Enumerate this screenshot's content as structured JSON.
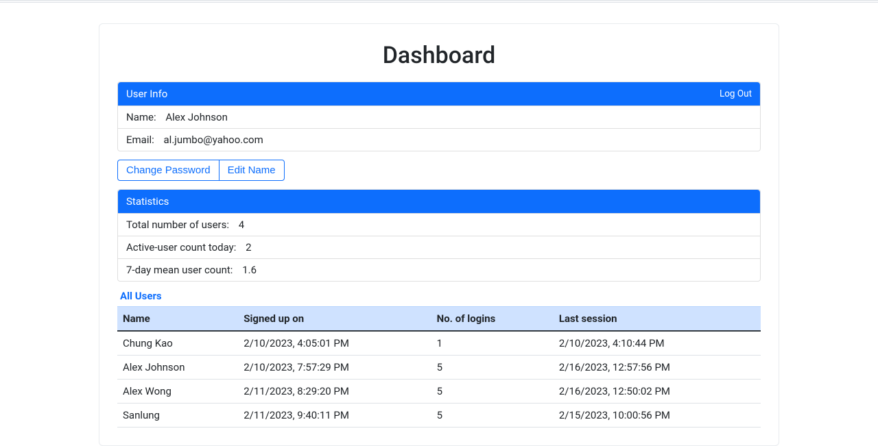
{
  "page": {
    "title": "Dashboard"
  },
  "userInfo": {
    "header": "User Info",
    "logout": "Log Out",
    "nameLabel": "Name:",
    "nameValue": "Alex Johnson",
    "emailLabel": "Email:",
    "emailValue": "al.jumbo@yahoo.com"
  },
  "buttons": {
    "changePassword": "Change Password",
    "editName": "Edit Name"
  },
  "statistics": {
    "header": "Statistics",
    "totalLabel": "Total number of users:",
    "totalValue": "4",
    "activeLabel": "Active-user count today:",
    "activeValue": "2",
    "meanLabel": "7-day mean user count:",
    "meanValue": "1.6"
  },
  "allUsers": {
    "title": "All Users",
    "columns": {
      "name": "Name",
      "signedUp": "Signed up on",
      "logins": "No. of logins",
      "lastSession": "Last session"
    },
    "rows": [
      {
        "name": "Chung Kao",
        "signedUp": "2/10/2023, 4:05:01 PM",
        "logins": "1",
        "lastSession": "2/10/2023, 4:10:44 PM"
      },
      {
        "name": "Alex Johnson",
        "signedUp": "2/10/2023, 7:57:29 PM",
        "logins": "5",
        "lastSession": "2/16/2023, 12:57:56 PM"
      },
      {
        "name": "Alex Wong",
        "signedUp": "2/11/2023, 8:29:20 PM",
        "logins": "5",
        "lastSession": "2/16/2023, 12:50:02 PM"
      },
      {
        "name": "Sanlung",
        "signedUp": "2/11/2023, 9:40:11 PM",
        "logins": "5",
        "lastSession": "2/15/2023, 10:00:56 PM"
      }
    ]
  }
}
